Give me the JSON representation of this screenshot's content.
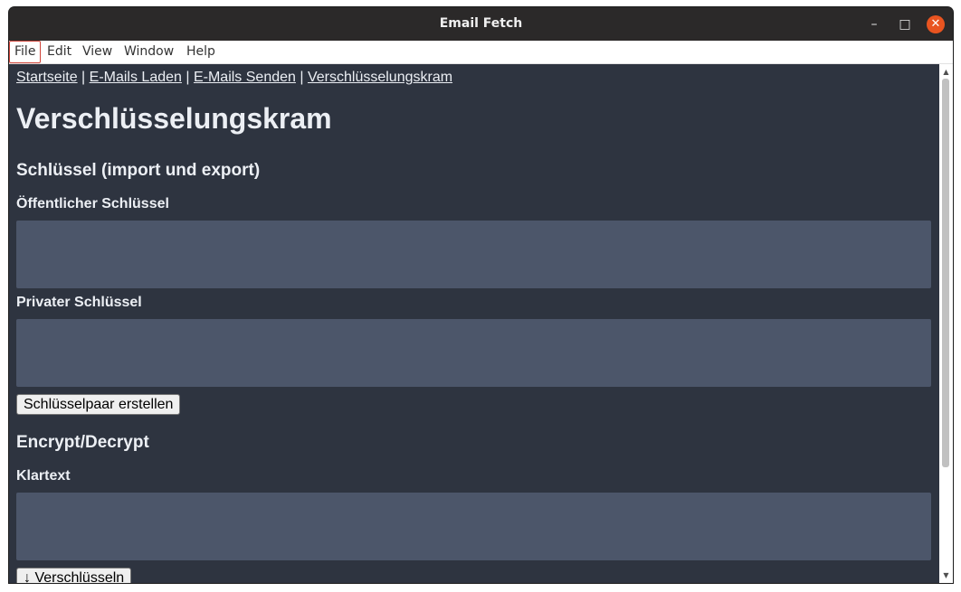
{
  "window": {
    "title": "Email Fetch",
    "controls": {
      "minimize": "–",
      "maximize": "□",
      "close": "✕"
    }
  },
  "menubar": {
    "items": [
      {
        "label": "File"
      },
      {
        "label": "Edit"
      },
      {
        "label": "View"
      },
      {
        "label": "Window"
      },
      {
        "label": "Help"
      }
    ]
  },
  "nav": {
    "links": [
      "Startseite",
      "E-Mails Laden",
      "E-Mails Senden",
      "Verschlüsselungskram"
    ],
    "separator": " | "
  },
  "page": {
    "title": "Verschlüsselungskram",
    "keys_section": {
      "heading": "Schlüssel (import und export)",
      "public_key_label": "Öffentlicher Schlüssel",
      "public_key_value": "",
      "private_key_label": "Privater Schlüssel",
      "private_key_value": "",
      "generate_button": "Schlüsselpaar erstellen"
    },
    "crypt_section": {
      "heading": "Encrypt/Decrypt",
      "plaintext_label": "Klartext",
      "plaintext_value": "",
      "encrypt_button": "↓ Verschlüsseln"
    }
  },
  "colors": {
    "background": "#2e3440",
    "field": "#4c566a",
    "text": "#eceff4",
    "close_button": "#e95420"
  }
}
